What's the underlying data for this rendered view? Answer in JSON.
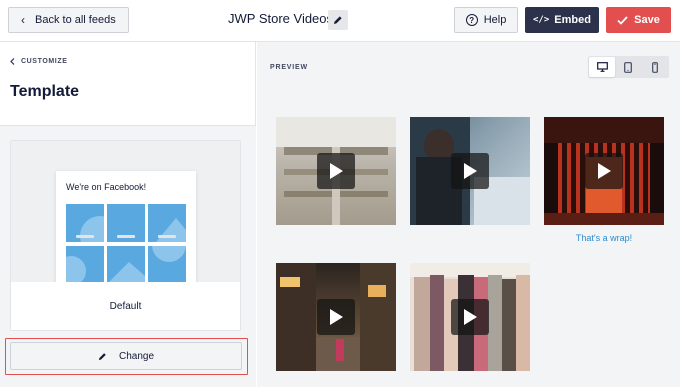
{
  "header": {
    "back_label": "Back to all feeds",
    "feed_title": "JWP Store Videos",
    "help_label": "Help",
    "embed_label": "Embed",
    "save_label": "Save"
  },
  "sidebar": {
    "customize_label": "CUSTOMIZE",
    "heading": "Template",
    "template_preview_title": "We're on Facebook!",
    "template_name": "Default",
    "change_label": "Change"
  },
  "preview": {
    "label": "PREVIEW",
    "devices": [
      "desktop-icon",
      "tablet-icon",
      "mobile-icon"
    ],
    "active_device": "desktop",
    "videos": [
      {
        "name": "video-mall-atrium",
        "caption": ""
      },
      {
        "name": "video-sewing-workshop",
        "caption": ""
      },
      {
        "name": "video-red-storefront",
        "caption": "That's a wrap!"
      },
      {
        "name": "video-night-street",
        "caption": ""
      },
      {
        "name": "video-clothing-rack",
        "caption": ""
      }
    ]
  },
  "colors": {
    "accent": "#e34f4f",
    "embed": "#2c324c",
    "link": "#2c8bcf",
    "mock_tile": "#59a8e0"
  }
}
